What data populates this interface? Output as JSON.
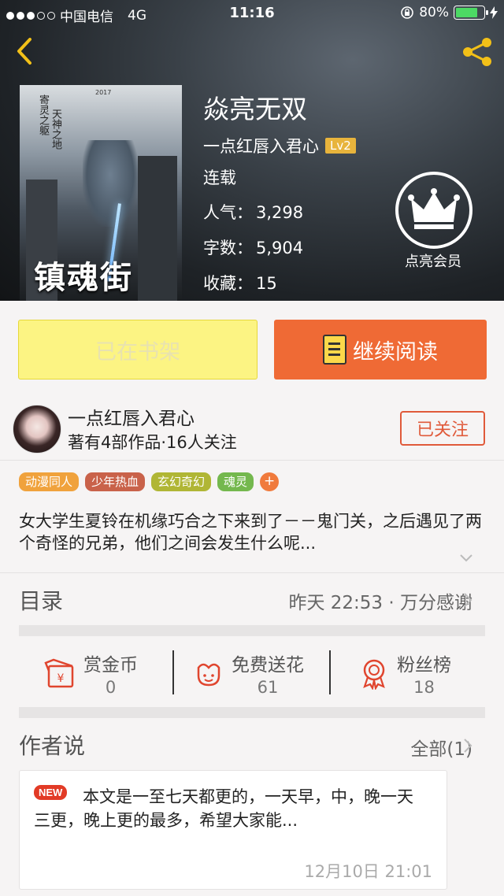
{
  "status_bar": {
    "carrier": "中国电信",
    "network": "4G",
    "time": "11:16",
    "battery": "80%",
    "battery_level": 0.8
  },
  "book": {
    "cover_title": "镇魂街",
    "cover_year": "2017",
    "cover_vtext_1": "寄灵之躯",
    "cover_vtext_2": "天神之地",
    "title": "焱亮无双",
    "author": "一点红唇入君心",
    "level": "Lv2",
    "status": "连载",
    "stats": [
      {
        "label": "人气：",
        "value": "3,298"
      },
      {
        "label": "字数：",
        "value": "5,904"
      },
      {
        "label": "收藏：",
        "value": "15"
      }
    ],
    "vip_label": "点亮会员"
  },
  "actions": {
    "shelf_label": "已在书架",
    "read_label": "继续阅读"
  },
  "author_card": {
    "name": "一点红唇入君心",
    "meta": "著有4部作品·16人关注",
    "follow_label": "已关注"
  },
  "tags": [
    {
      "label": "动漫同人",
      "color": "#f0a23c"
    },
    {
      "label": "少年热血",
      "color": "#c9624a"
    },
    {
      "label": "玄幻奇幻",
      "color": "#b0b635"
    },
    {
      "label": "魂灵",
      "color": "#74b84e"
    }
  ],
  "tag_more": "+",
  "description": "女大学生夏铃在机缘巧合之下来到了－－鬼门关，之后遇见了两个奇怪的兄弟，他们之间会发生什么呢...",
  "catalog": {
    "title": "目录",
    "latest": "昨天 22:53 · 万分感谢"
  },
  "rewards": [
    {
      "label": "赏金币",
      "value": "0",
      "icon": "gold-coin-icon"
    },
    {
      "label": "免费送花",
      "value": "61",
      "icon": "flower-icon"
    },
    {
      "label": "粉丝榜",
      "value": "18",
      "icon": "medal-icon"
    }
  ],
  "author_notes": {
    "title": "作者说",
    "more_label": "全部(1)",
    "badge": "NEW",
    "text": "本文是一至七天都更的，一天早，中，晚一天三更，晚上更的最多，希望大家能...",
    "date": "12月10日  21:01"
  },
  "colors": {
    "accent_orange": "#ef6a35",
    "shelf_yellow": "#fcf483",
    "follow_red": "#e05a3a",
    "level_gold": "#e8b43c"
  }
}
